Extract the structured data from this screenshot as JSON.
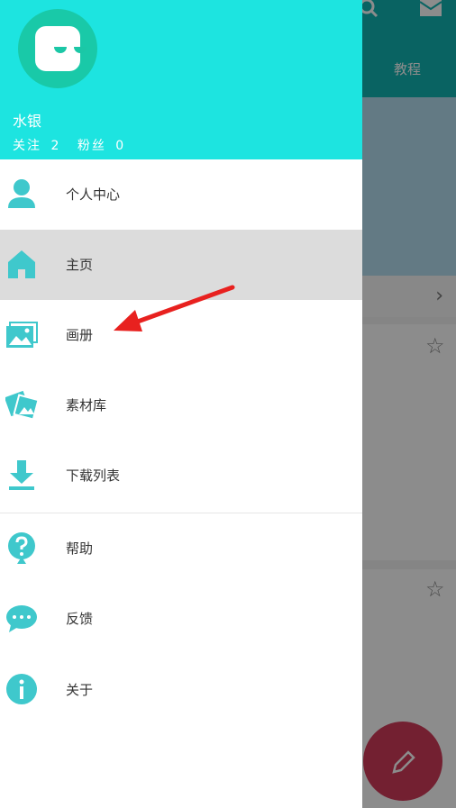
{
  "background_app": {
    "tab_label": "教程"
  },
  "profile": {
    "username": "水银",
    "follow_label": "关注",
    "follow_count": "2",
    "fans_label": "粉丝",
    "fans_count": "0"
  },
  "menu": {
    "items": [
      {
        "label": "个人中心",
        "icon": "person-icon"
      },
      {
        "label": "主页",
        "icon": "home-icon"
      },
      {
        "label": "画册",
        "icon": "album-icon"
      },
      {
        "label": "素材库",
        "icon": "material-library-icon"
      },
      {
        "label": "下载列表",
        "icon": "download-icon"
      },
      {
        "label": "帮助",
        "icon": "help-icon"
      },
      {
        "label": "反馈",
        "icon": "feedback-icon"
      },
      {
        "label": "关于",
        "icon": "info-icon"
      }
    ],
    "active_index": 1
  },
  "colors": {
    "accent": "#1de4e0",
    "icon": "#3fc8cc",
    "arrow": "#e8211f",
    "fab": "#d23b5a"
  }
}
